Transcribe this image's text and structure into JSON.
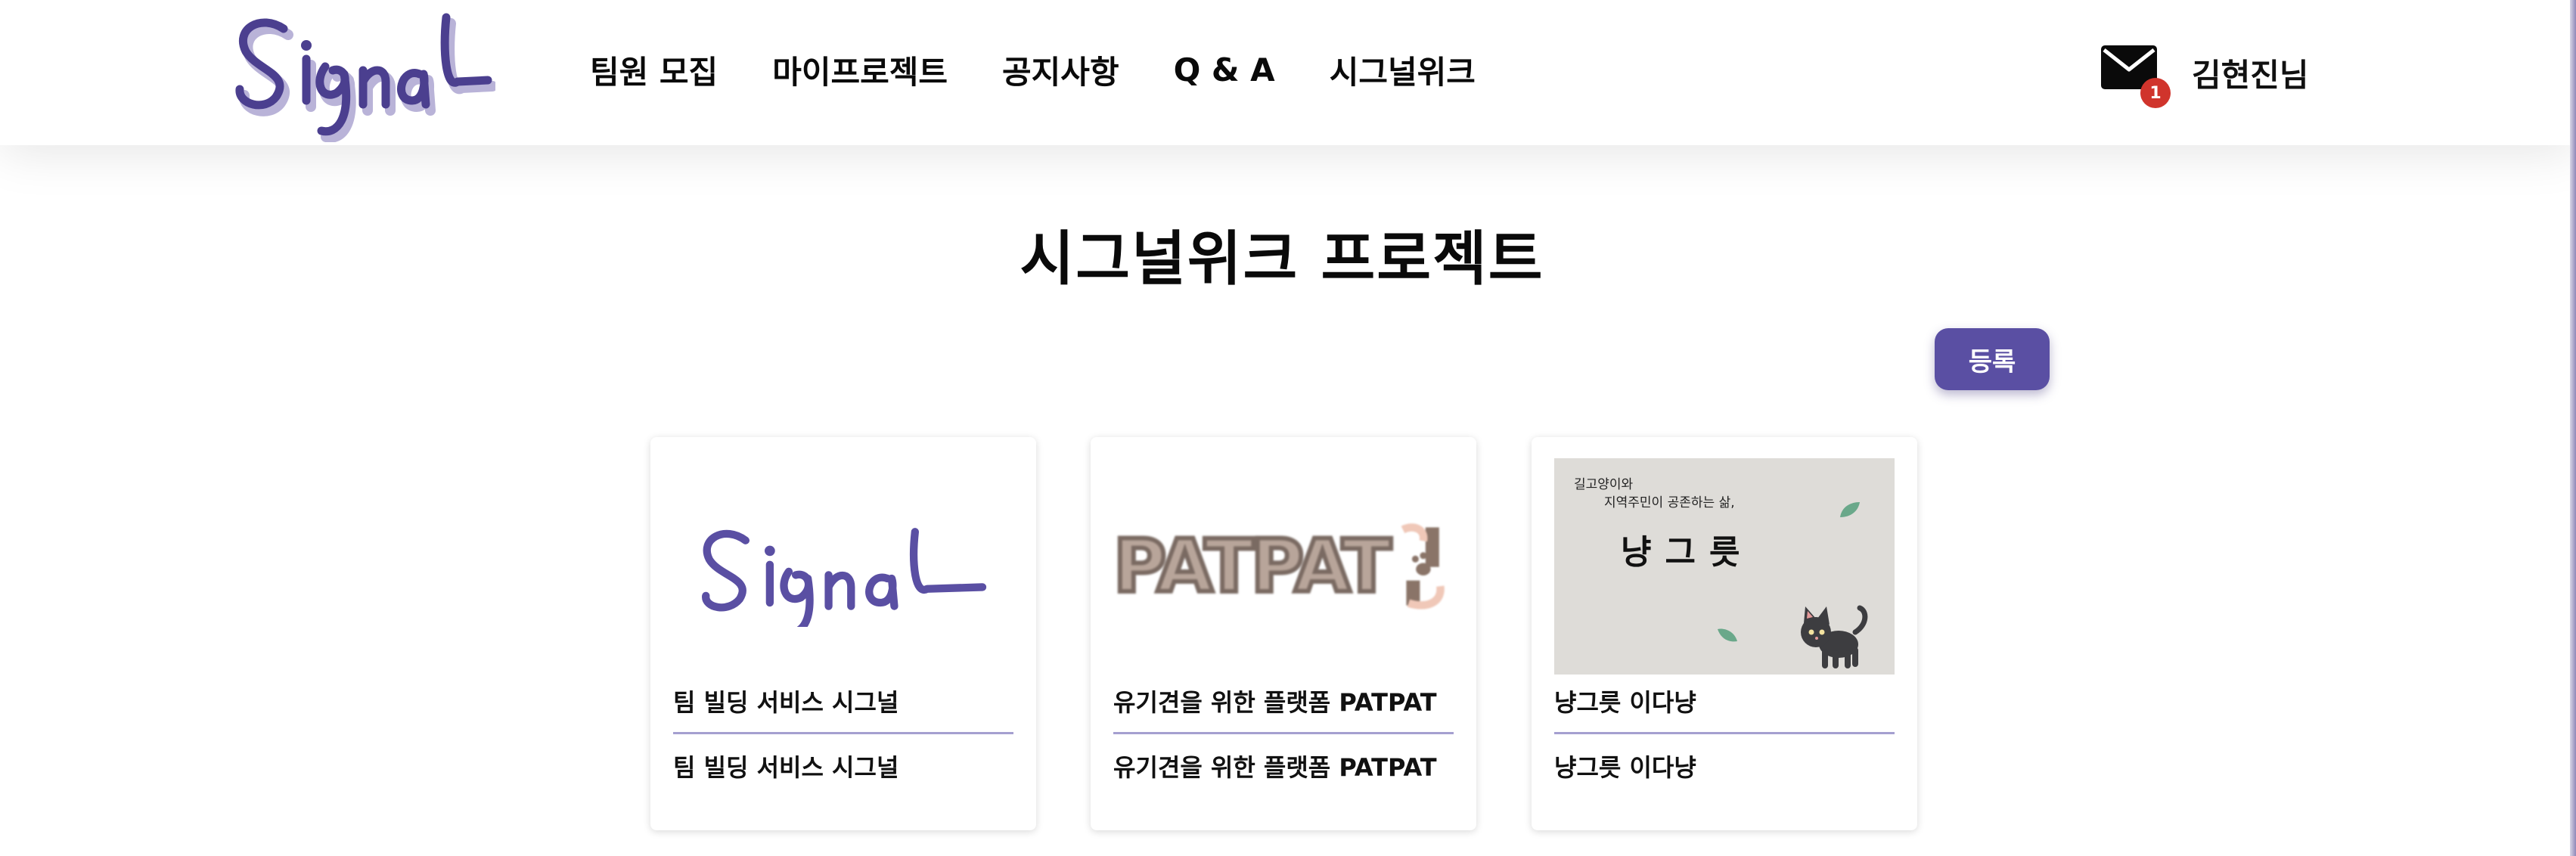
{
  "header": {
    "logo_text": "Signal",
    "nav": [
      {
        "label": "팀원 모집"
      },
      {
        "label": "마이프로젝트"
      },
      {
        "label": "공지사항"
      },
      {
        "label": "Q & A"
      },
      {
        "label": "시그널위크"
      }
    ],
    "mail": {
      "icon": "mail-icon",
      "badge_count": "1"
    },
    "user_name": "김현진님"
  },
  "main": {
    "title": "시그널위크 프로젝트",
    "register_label": "등록",
    "cards": [
      {
        "image": "Signal logo",
        "title": "팀 빌딩 서비스 시그널",
        "description": "팀 빌딩 서비스 시그널"
      },
      {
        "image": "PATPAT logo",
        "image_text": "PATPAT",
        "title": "유기견을 위한 플랫폼 PATPAT",
        "description": "유기견을 위한 플랫폼 PATPAT"
      },
      {
        "image": "cat illustration",
        "image_line1": "길고양이와",
        "image_line2": "지역주민이 공존하는 삶,",
        "image_brand": "냥그릇",
        "title": "냥그릇 이다냥",
        "description": "냥그릇 이다냥"
      }
    ]
  },
  "colors": {
    "accent": "#5a4fa3",
    "divider": "#a59fd0",
    "badge": "#d0342c",
    "logo": "#4b3f8f"
  }
}
